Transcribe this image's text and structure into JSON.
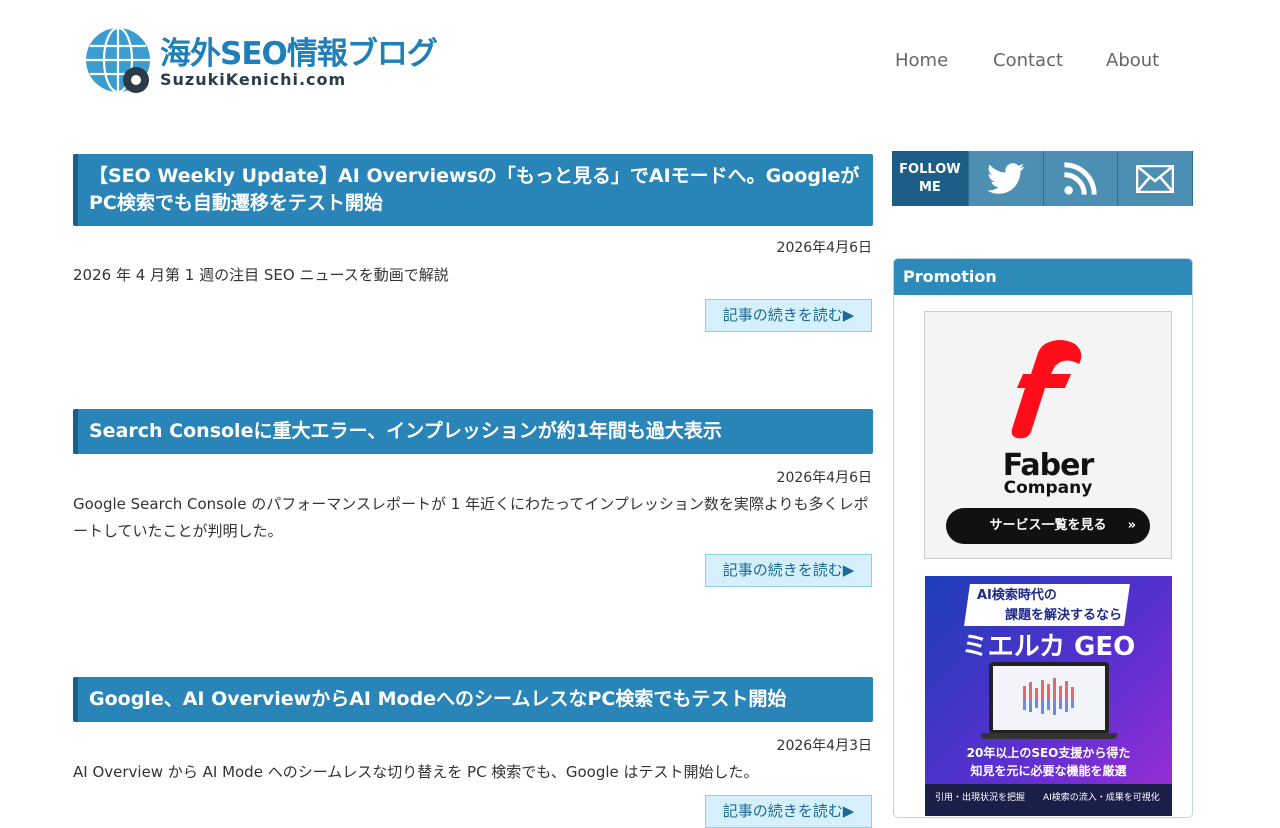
{
  "header": {
    "logo_title": "海外SEO情報ブログ",
    "logo_subtitle": "SuzukiKenichi.com",
    "nav": [
      "Home",
      "Contact",
      "About"
    ]
  },
  "posts": [
    {
      "title": "【SEO Weekly Update】AI Overviewsの「もっと見る」でAIモードへ。GoogleがPC検索でも自動遷移をテスト開始",
      "date": "2026年4月6日",
      "excerpt": "2026 年 4 月第 1 週の注目 SEO ニュースを動画で解説",
      "read_more": "記事の続きを読む▶"
    },
    {
      "title": "Search Consoleに重大エラー、インプレッションが約1年間も過大表示",
      "date": "2026年4月6日",
      "excerpt": "Google Search Console のパフォーマンスレポートが 1 年近くにわたってインプレッション数を実際よりも多くレポートしていたことが判明した。",
      "read_more": "記事の続きを読む▶"
    },
    {
      "title": "Google、AI OverviewからAI ModeへのシームレスなPC検索でもテスト開始",
      "date": "2026年4月3日",
      "excerpt": "AI Overview から AI Mode へのシームレスな切り替えを PC 検索でも、Google はテスト開始した。",
      "read_more": "記事の続きを読む▶"
    }
  ],
  "sidebar": {
    "follow_label": "FOLLOW ME",
    "follow_icons": [
      "twitter-icon",
      "rss-icon",
      "mail-icon"
    ],
    "promotion_title": "Promotion",
    "ad1": {
      "brand_line1": "Faber",
      "brand_line2": "Company",
      "button": "サービス一覧を見る"
    },
    "ad2": {
      "line1": "AI検索時代の",
      "line2": "課題を解決するなら",
      "product": "ミエルカ GEO",
      "tagline1": "20年以上のSEO支援から得た",
      "tagline2": "知見を元に必要な機能を厳選",
      "bullet1": "引用・出現状況を把握",
      "bullet2": "AI検索の流入・成果を可視化"
    }
  },
  "colors": {
    "accent": "#2984b8",
    "title_bar": "#2984b8",
    "promo_head": "#2e8ab8"
  }
}
